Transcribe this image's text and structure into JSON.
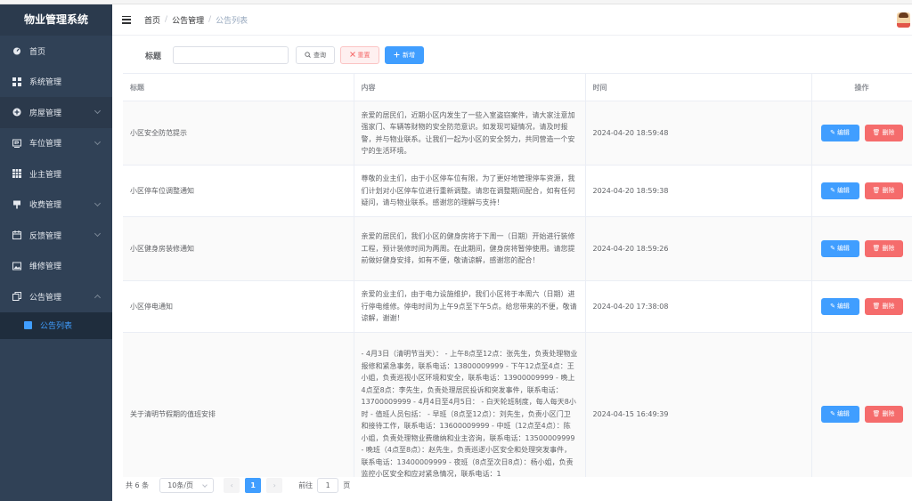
{
  "app": {
    "title": "物业管理系统"
  },
  "sidebar": {
    "items": [
      {
        "label": "首页",
        "icon": "dashboard-icon"
      },
      {
        "label": "系统管理",
        "icon": "grid-icon"
      },
      {
        "label": "房屋管理",
        "icon": "circle-plus-icon"
      },
      {
        "label": "车位管理",
        "icon": "parking-icon"
      },
      {
        "label": "业主管理",
        "icon": "table-icon"
      },
      {
        "label": "收费管理",
        "icon": "pin-icon"
      },
      {
        "label": "反馈管理",
        "icon": "calendar-icon"
      },
      {
        "label": "维修管理",
        "icon": "picture-icon"
      },
      {
        "label": "公告管理",
        "icon": "copy-icon"
      }
    ],
    "active_sub": {
      "label": "公告列表"
    }
  },
  "breadcrumb": {
    "home": "首页",
    "parent": "公告管理",
    "current": "公告列表",
    "sep": "/"
  },
  "filter": {
    "label": "标题",
    "placeholder": "",
    "search_label": "查询",
    "reset_label": "重置",
    "add_label": "新增"
  },
  "table": {
    "headers": {
      "title": "标题",
      "content": "内容",
      "time": "时间",
      "op": "操作"
    },
    "rows": [
      {
        "title": "小区安全防范提示",
        "content": "亲爱的居民们，近期小区内发生了一些入室盗窃案件，请大家注意加强家门、车辆等财物的安全防范意识。如发现可疑情况，请及时报警，并与物业联系。让我们一起为小区的安全努力，共同营造一个安宁的生活环境。",
        "time": "2024-04-20 18:59:48"
      },
      {
        "title": "小区停车位调整通知",
        "content": "尊敬的业主们，由于小区停车位有限，为了更好地管理停车资源，我们计划对小区停车位进行重新调整。请您在调整期间配合，如有任何疑问，请与物业联系。感谢您的理解与支持！",
        "time": "2024-04-20 18:59:38"
      },
      {
        "title": "小区健身房装修通知",
        "content": "亲爱的居民们，我们小区的健身房将于下周一（日期）开始进行装修工程，预计装修时间为两周。在此期间，健身房将暂停使用。请您提前做好健身安排，如有不便，敬请谅解，感谢您的配合！",
        "time": "2024-04-20 18:59:26"
      },
      {
        "title": "小区停电通知",
        "content": "亲爱的业主们，由于电力设施维护，我们小区将于本周六（日期）进行停电维修。停电时间为上午9点至下午5点。给您带来的不便，敬请谅解，谢谢！",
        "time": "2024-04-20 17:38:08"
      },
      {
        "title": "关于清明节假期的值班安排",
        "content": "- 4月3日（清明节当天）： - 上午8点至12点：张先生，负责处理物业报修和紧急事务，联系电话：13800009999 - 下午12点至4点：王小姐，负责巡视小区环境和安全，联系电话：13900009999 - 晚上4点至8点：李先生，负责处理居民投诉和突发事件，联系电话：13700009999 - 4月4日至4月5日： - 白天轮班制度，每人每天8小时 - 值班人员包括： - 早班（8点至12点）：刘先生，负责小区门卫和接待工作，联系电话：13600009999 - 中班（12点至4点）：陈小姐，负责处理物业费缴纳和业主咨询，联系电话：13500009999 - 晚班（4点至8点）：赵先生，负责巡逻小区安全和处理突发事件，联系电话：13400009999 - 夜班（8点至次日8点）：杨小姐，负责监控小区安全和应对紧急情况，联系电话：1",
        "time": "2024-04-15 16:49:39"
      }
    ],
    "edit_label": "编辑",
    "delete_label": "删除"
  },
  "pagination": {
    "total": "共 6 条",
    "page_size": "10条/页",
    "current_page": "1",
    "goto_prefix": "前往",
    "goto_value": "1",
    "goto_suffix": "页",
    "prev": "‹",
    "next": "›"
  },
  "colors": {
    "sidebar_bg": "#304156",
    "primary": "#409eff",
    "danger": "#f56c6c"
  }
}
